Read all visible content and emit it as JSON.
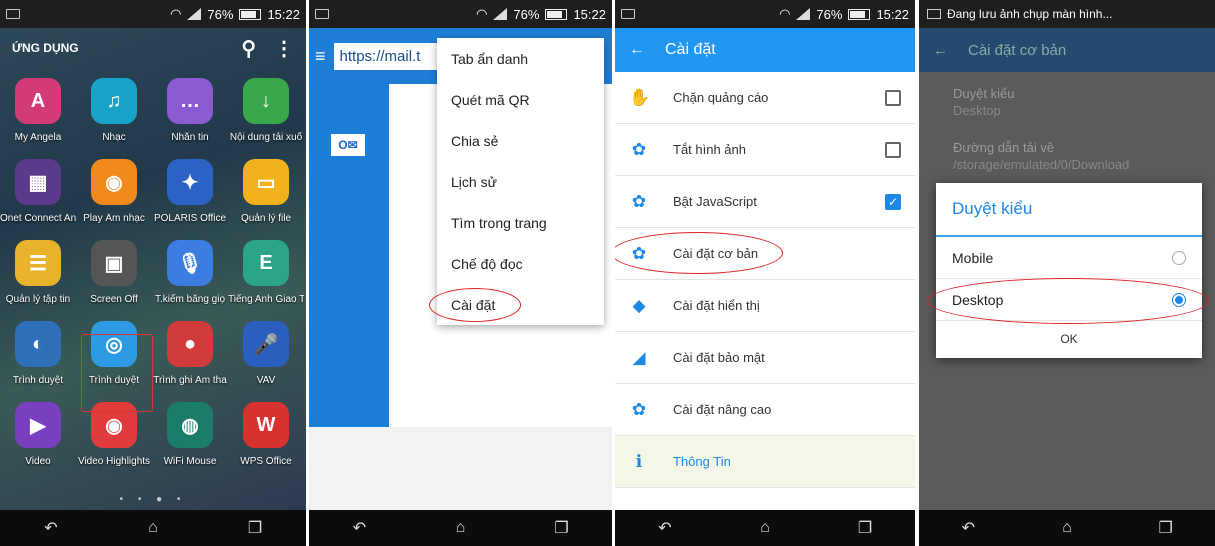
{
  "status": {
    "battery": "76%",
    "time": "15:22"
  },
  "launcher": {
    "title": "ỨNG DỤNG",
    "apps": [
      {
        "label": "My Angela",
        "icon": "angela-icon",
        "color": "#d23b78",
        "glyph": "A"
      },
      {
        "label": "Nhạc",
        "icon": "music-icon",
        "color": "#1aa3c8",
        "glyph": "♫"
      },
      {
        "label": "Nhắn tin",
        "icon": "message-icon",
        "color": "#8b5bd1",
        "glyph": "…"
      },
      {
        "label": "Nội dung tải xuố",
        "icon": "download-icon",
        "color": "#39a84a",
        "glyph": "↓"
      },
      {
        "label": "Onet Connect An",
        "icon": "onet-icon",
        "color": "#5b3a8c",
        "glyph": "▦"
      },
      {
        "label": "Play Âm nhạc",
        "icon": "play-music-icon",
        "color": "#f08a1c",
        "glyph": "◉"
      },
      {
        "label": "POLARIS Office",
        "icon": "polaris-icon",
        "color": "#2d62c5",
        "glyph": "✦"
      },
      {
        "label": "Quản lý file",
        "icon": "file-manager-icon",
        "color": "#f2b21c",
        "glyph": "▭"
      },
      {
        "label": "Quản lý tập tin",
        "icon": "folder-icon",
        "color": "#e8b32a",
        "glyph": "☰"
      },
      {
        "label": "Screen Off",
        "icon": "screen-off-icon",
        "color": "#555555",
        "glyph": "▣"
      },
      {
        "label": "T.kiếm bằng giọ",
        "icon": "voice-search-icon",
        "color": "#3b7de0",
        "glyph": "🎙"
      },
      {
        "label": "Tiếng Anh Giao T",
        "icon": "english-icon",
        "color": "#2aa58a",
        "glyph": "E"
      },
      {
        "label": "Trình duyệt",
        "icon": "browser-icon",
        "color": "#2d6fb8",
        "glyph": "◐"
      },
      {
        "label": "Trình duyệt",
        "icon": "browser-alt-icon",
        "color": "#2c9be3",
        "glyph": "◎"
      },
      {
        "label": "Trình ghi Âm tha",
        "icon": "recorder-icon",
        "color": "#d23b3b",
        "glyph": "●"
      },
      {
        "label": "VAV",
        "icon": "vav-icon",
        "color": "#2a5fc0",
        "glyph": "🎤"
      },
      {
        "label": "Video",
        "icon": "video-icon",
        "color": "#7a3fc0",
        "glyph": "▶"
      },
      {
        "label": "Video Highlights",
        "icon": "video-highlights-icon",
        "color": "#e23b3b",
        "glyph": "◉"
      },
      {
        "label": "WiFi Mouse",
        "icon": "wifi-mouse-icon",
        "color": "#1c7c6a",
        "glyph": "◍"
      },
      {
        "label": "WPS Office",
        "icon": "wps-icon",
        "color": "#d8322f",
        "glyph": "W"
      }
    ]
  },
  "browser": {
    "url": "https://mail.t",
    "menu": [
      "Tab ẩn danh",
      "Quét mã QR",
      "Chia sẻ",
      "Lịch sử",
      "Tìm trong trang",
      "Chế độ đọc",
      "Cài đặt"
    ]
  },
  "settings": {
    "title": "Cài đặt",
    "rows": [
      {
        "label": "Chặn quảng cáo",
        "checkbox": "off"
      },
      {
        "label": "Tắt hình ảnh",
        "checkbox": "off"
      },
      {
        "label": "Bật JavaScript",
        "checkbox": "on"
      },
      {
        "label": "Cài đặt cơ bản"
      },
      {
        "label": "Cài đặt hiển thị"
      },
      {
        "label": "Cài đặt bảo mật"
      },
      {
        "label": "Cài đặt nâng cao"
      },
      {
        "label": "Thông Tin"
      }
    ]
  },
  "basic": {
    "saving": "Đang lưu ảnh chụp màn hình...",
    "title": "Cài đặt cơ bản",
    "browse_label": "Duyệt kiểu",
    "browse_value": "Desktop",
    "download_label": "Đường dẫn tải về",
    "download_value": "/storage/emulated/0/Download",
    "dialog_title": "Duyệt kiểu",
    "opt_mobile": "Mobile",
    "opt_desktop": "Desktop",
    "ok": "OK"
  }
}
